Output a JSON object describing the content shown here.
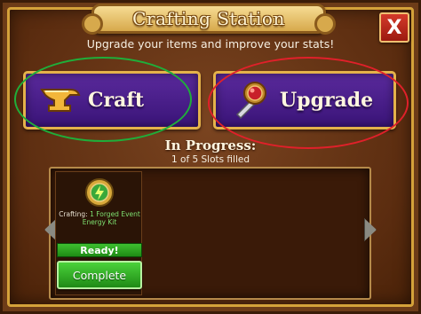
{
  "window": {
    "title": "Crafting Station",
    "subtitle": "Upgrade your items and improve your stats!",
    "close_label": "X"
  },
  "actions": {
    "craft_label": "Craft",
    "upgrade_label": "Upgrade"
  },
  "progress": {
    "title": "In Progress:",
    "slots_text": "1 of 5 Slots filled",
    "slots_filled": 1,
    "slots_total": 5
  },
  "slot": {
    "crafting_prefix": "Crafting: ",
    "item_name": "1 Forged Event Energy Kit",
    "status": "Ready!",
    "complete_label": "Complete"
  },
  "icons": {
    "close": "close-icon",
    "craft": "anvil-icon",
    "upgrade": "gem-sword-icon",
    "slot_item": "energy-kit-badge-icon",
    "prev": "arrow-left-icon",
    "next": "arrow-right-icon"
  },
  "annotations": {
    "green_circle_color": "#1fae3a",
    "red_circle_color": "#e0202a"
  },
  "colors": {
    "frame": "#6d3c18",
    "gold_trim": "#e4b24a",
    "button_purple": "#4a1f8a",
    "complete_green": "#2fae22"
  }
}
